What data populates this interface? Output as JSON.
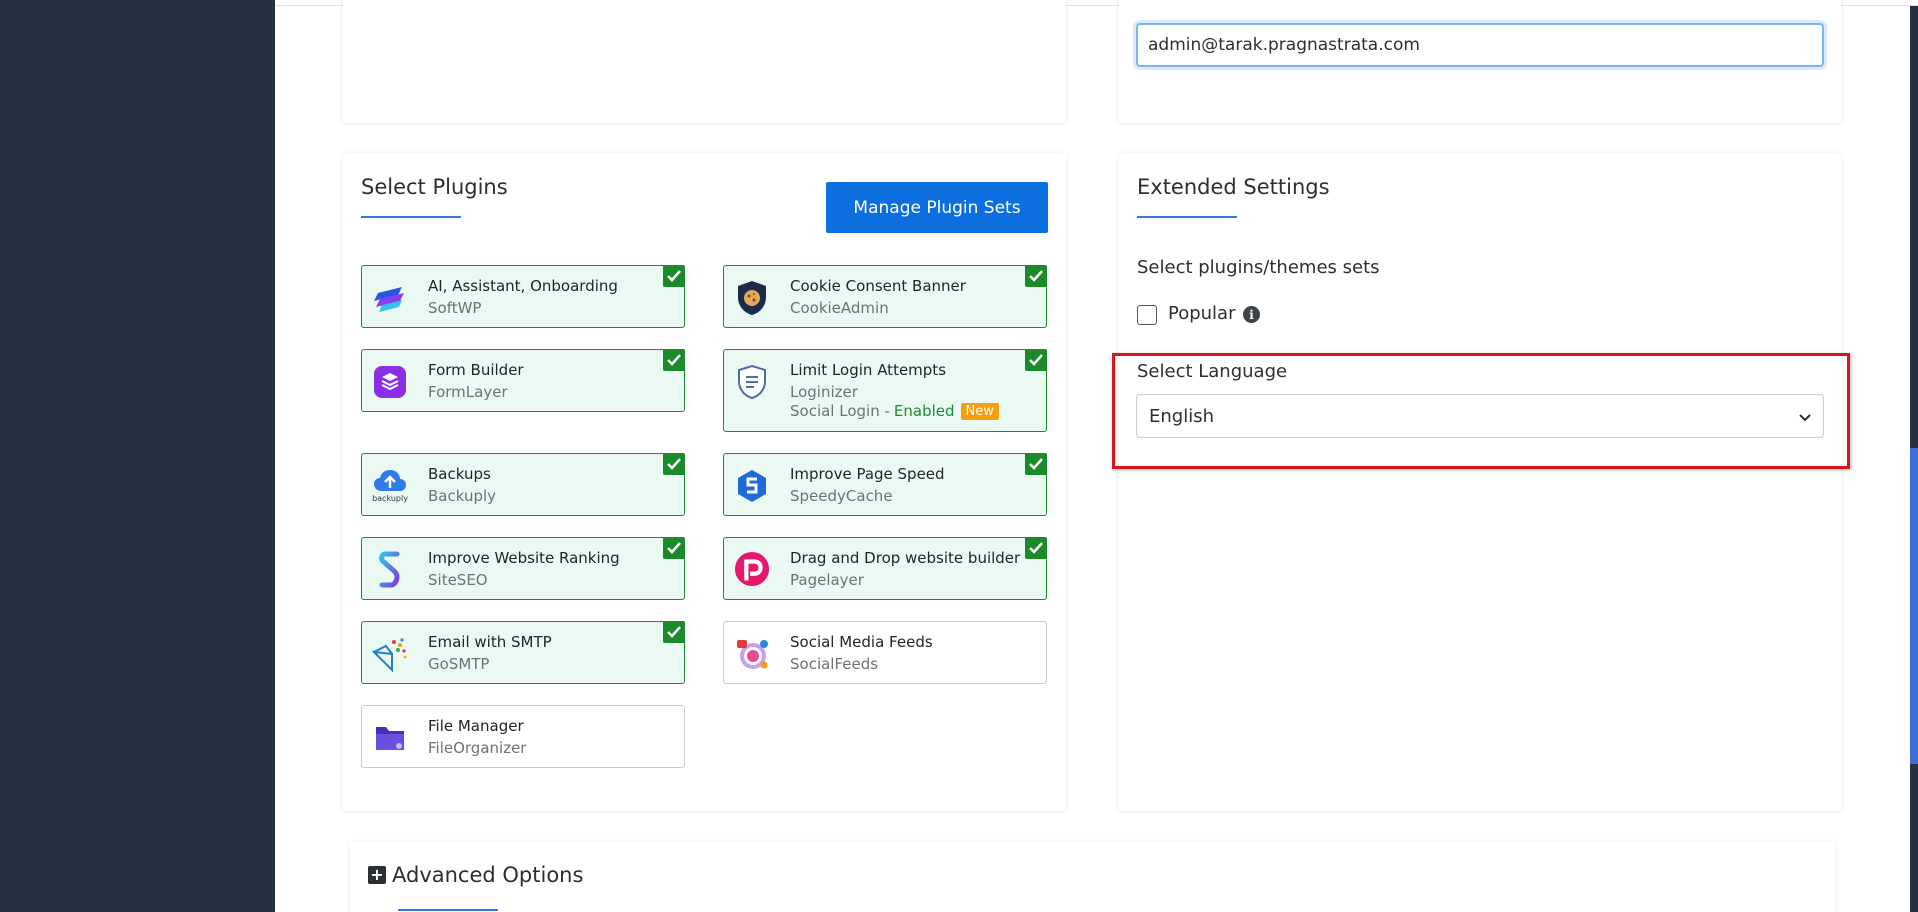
{
  "credentials": {
    "admin_email_value": "admin@tarak.pragnastrata.com"
  },
  "plugins_card": {
    "title": "Select Plugins",
    "manage_button_label": "Manage Plugin Sets",
    "items": [
      {
        "name": "AI, Assistant, Onboarding",
        "vendor": "SoftWP",
        "checked": true,
        "icon": "softwp-icon"
      },
      {
        "name": "Cookie Consent Banner",
        "vendor": "CookieAdmin",
        "checked": true,
        "icon": "cookieadmin-icon"
      },
      {
        "name": "Form Builder",
        "vendor": "FormLayer",
        "checked": true,
        "icon": "formlayer-icon"
      },
      {
        "name": "Limit Login Attempts",
        "vendor": "Loginizer",
        "checked": true,
        "icon": "loginizer-icon",
        "extra_prefix": "Social Login - ",
        "extra_enabled": "Enabled",
        "extra_badge": "New"
      },
      {
        "name": "Backups",
        "vendor": "Backuply",
        "checked": true,
        "icon": "backuply-icon",
        "icon_caption": "backuply"
      },
      {
        "name": "Improve Page Speed",
        "vendor": "SpeedyCache",
        "checked": true,
        "icon": "speedycache-icon"
      },
      {
        "name": "Improve Website Ranking",
        "vendor": "SiteSEO",
        "checked": true,
        "icon": "siteseo-icon"
      },
      {
        "name": "Drag and Drop website builder",
        "vendor": "Pagelayer",
        "checked": true,
        "icon": "pagelayer-icon"
      },
      {
        "name": "Email with SMTP",
        "vendor": "GoSMTP",
        "checked": true,
        "icon": "gosmtp-icon"
      },
      {
        "name": "Social Media Feeds",
        "vendor": "SocialFeeds",
        "checked": false,
        "icon": "socialfeeds-icon"
      },
      {
        "name": "File Manager",
        "vendor": "FileOrganizer",
        "checked": false,
        "icon": "fileorganizer-icon"
      }
    ]
  },
  "extended_card": {
    "title": "Extended Settings",
    "sets_label": "Select plugins/themes sets",
    "popular_label": "Popular",
    "popular_checked": false,
    "language_label": "Select Language",
    "language_selected": "English"
  },
  "advanced": {
    "title": "Advanced Options"
  },
  "colors": {
    "sidebar": "#243241",
    "accent": "#0d6ee0",
    "checked_border": "#1a8a2a",
    "checked_bg": "#eafaf3",
    "highlight": "#d8141c",
    "new_badge": "#f59e0b"
  }
}
